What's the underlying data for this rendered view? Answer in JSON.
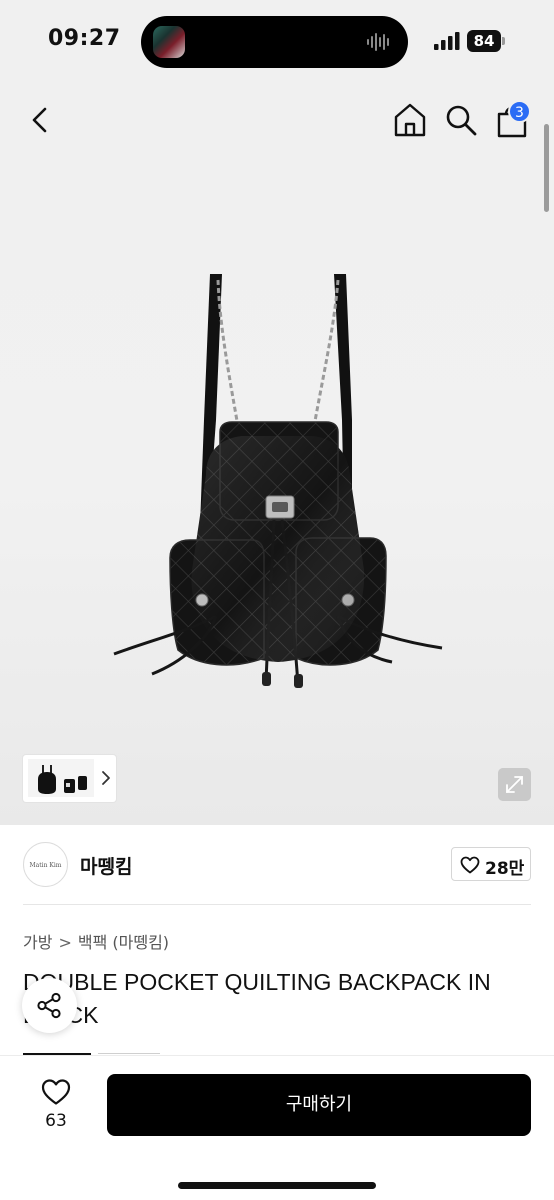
{
  "status_bar": {
    "time": "09:27",
    "battery": "84",
    "icons": [
      "island-avatar",
      "audio-wave-icon",
      "signal-icon",
      "battery-icon"
    ]
  },
  "nav": {
    "icons": [
      "back-icon",
      "home-icon",
      "search-icon",
      "shopping-bag-icon"
    ],
    "cart_count": "3"
  },
  "gallery": {
    "image": "black-quilted-backpack-photo",
    "thumbnail_icons": [
      "thumbnail-image",
      "chevron-right-icon"
    ],
    "expand_icon": "expand-icon"
  },
  "seller": {
    "logo_text": "Matin Kim",
    "name": "마뗑킴",
    "follow_count": "28만"
  },
  "product": {
    "breadcrumb": [
      "가방",
      "백팩 (마뗑킴)"
    ],
    "breadcrumb_separator": ">",
    "title": "DOUBLE POCKET QUILTING BACKPACK IN BLACK"
  },
  "bottom_bar": {
    "like_count": "63",
    "buy_label": "구매하기"
  },
  "colors": {
    "accent_badge": "#2b6cf5",
    "buy_button": "#000000",
    "hero_background": "#f0f0f0"
  }
}
